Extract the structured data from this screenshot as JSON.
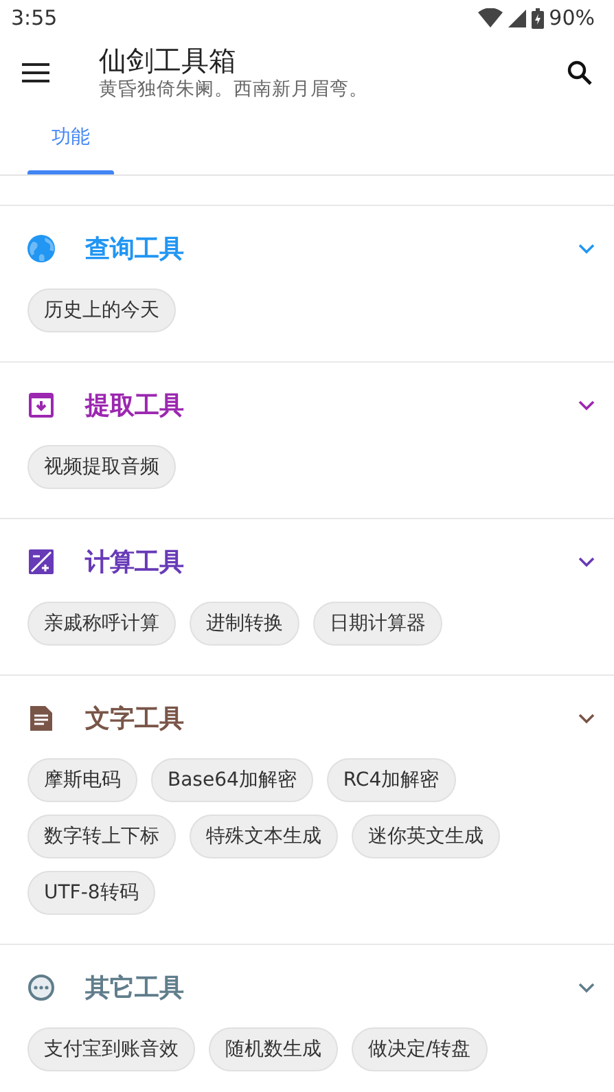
{
  "status_bar": {
    "time": "3:55",
    "battery": "90%"
  },
  "app_bar": {
    "title": "仙剑工具箱",
    "subtitle": "黄昏独倚朱阑。西南新月眉弯。"
  },
  "tabs": [
    {
      "label": "功能",
      "selected": true
    }
  ],
  "sections": [
    {
      "title": "查询工具",
      "kind": "globe",
      "color": "#2196f3",
      "tools": [
        "历史上的今天"
      ]
    },
    {
      "title": "提取工具",
      "kind": "archive",
      "color": "#9c27b0",
      "tools": [
        "视频提取音频"
      ]
    },
    {
      "title": "计算工具",
      "kind": "calculator",
      "color": "#673ab7",
      "tools": [
        "亲戚称呼计算",
        "进制转换",
        "日期计算器"
      ]
    },
    {
      "title": "文字工具",
      "kind": "document",
      "color": "#795548",
      "tools": [
        "摩斯电码",
        "Base64加解密",
        "RC4加解密",
        "数字转上下标",
        "特殊文本生成",
        "迷你英文生成",
        "UTF-8转码"
      ]
    },
    {
      "title": "其它工具",
      "kind": "more",
      "color": "#607d8b",
      "tools": [
        "支付宝到账音效",
        "随机数生成",
        "做决定/转盘"
      ]
    }
  ]
}
